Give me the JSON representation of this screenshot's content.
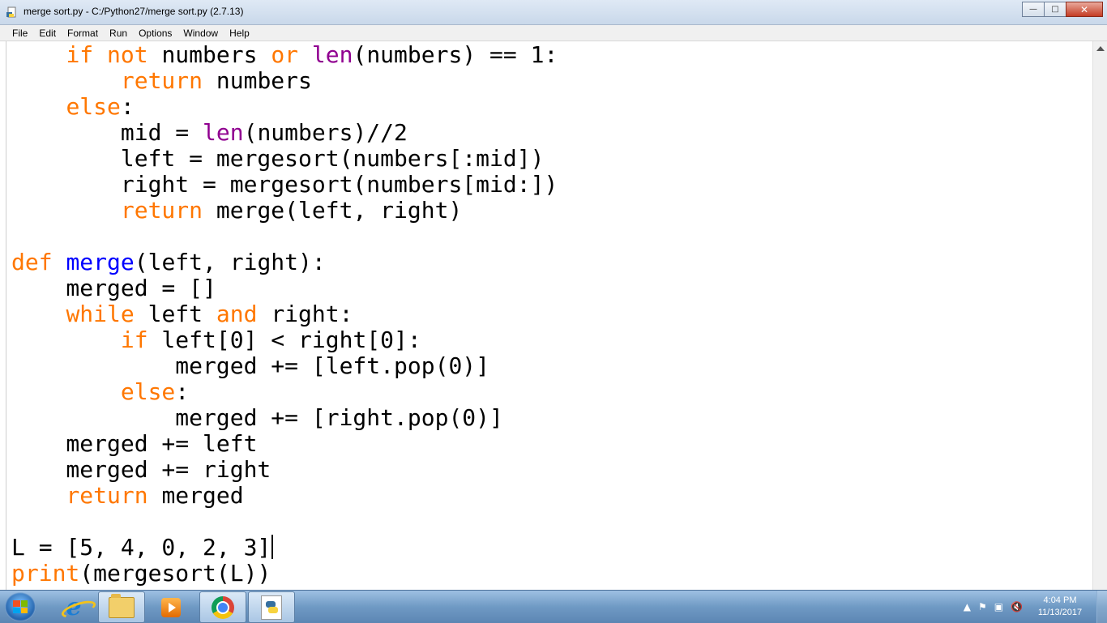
{
  "window": {
    "title": "merge sort.py - C:/Python27/merge sort.py (2.7.13)",
    "minimize_icon": "minimize-icon",
    "maximize_icon": "maximize-icon",
    "close_icon": "close-icon"
  },
  "menu": [
    "File",
    "Edit",
    "Format",
    "Run",
    "Options",
    "Window",
    "Help"
  ],
  "editor": {
    "lines": [
      [
        {
          "t": "    "
        },
        {
          "t": "if",
          "c": "kw"
        },
        {
          "t": " "
        },
        {
          "t": "not",
          "c": "kw"
        },
        {
          "t": " numbers "
        },
        {
          "t": "or",
          "c": "kw"
        },
        {
          "t": " "
        },
        {
          "t": "len",
          "c": "bi"
        },
        {
          "t": "(numbers) == 1:"
        }
      ],
      [
        {
          "t": "        "
        },
        {
          "t": "return",
          "c": "kw"
        },
        {
          "t": " numbers"
        }
      ],
      [
        {
          "t": "    "
        },
        {
          "t": "else",
          "c": "kw"
        },
        {
          "t": ":"
        }
      ],
      [
        {
          "t": "        mid = "
        },
        {
          "t": "len",
          "c": "bi"
        },
        {
          "t": "(numbers)//2"
        }
      ],
      [
        {
          "t": "        left = mergesort(numbers[:mid])"
        }
      ],
      [
        {
          "t": "        right = mergesort(numbers[mid:])"
        }
      ],
      [
        {
          "t": "        "
        },
        {
          "t": "return",
          "c": "kw"
        },
        {
          "t": " merge(left, right)"
        }
      ],
      [],
      [
        {
          "t": "def",
          "c": "kw"
        },
        {
          "t": " "
        },
        {
          "t": "merge",
          "c": "fn"
        },
        {
          "t": "(left, right):"
        }
      ],
      [
        {
          "t": "    merged = []"
        }
      ],
      [
        {
          "t": "    "
        },
        {
          "t": "while",
          "c": "kw"
        },
        {
          "t": " left "
        },
        {
          "t": "and",
          "c": "kw"
        },
        {
          "t": " right:"
        }
      ],
      [
        {
          "t": "        "
        },
        {
          "t": "if",
          "c": "kw"
        },
        {
          "t": " left[0] < right[0]:"
        }
      ],
      [
        {
          "t": "            merged += [left.pop(0)]"
        }
      ],
      [
        {
          "t": "        "
        },
        {
          "t": "else",
          "c": "kw"
        },
        {
          "t": ":"
        }
      ],
      [
        {
          "t": "            merged += [right.pop(0)]"
        }
      ],
      [
        {
          "t": "    merged += left"
        }
      ],
      [
        {
          "t": "    merged += right"
        }
      ],
      [
        {
          "t": "    "
        },
        {
          "t": "return",
          "c": "kw"
        },
        {
          "t": " merged"
        }
      ],
      [],
      [
        {
          "t": "L = [5, 4, 0, 2, 3]"
        },
        {
          "caret": true
        }
      ],
      [
        {
          "t": "print",
          "c": "kw"
        },
        {
          "t": "(mergesort(L))"
        }
      ]
    ],
    "colors": {
      "keyword": "#ff7700",
      "builtin": "#900090",
      "definition": "#0000ff",
      "text": "#000000"
    }
  },
  "taskbar": {
    "apps": [
      {
        "name": "internet-explorer-icon"
      },
      {
        "name": "file-explorer-icon"
      },
      {
        "name": "media-player-icon"
      },
      {
        "name": "chrome-icon"
      },
      {
        "name": "python-idle-icon"
      }
    ],
    "tray_icons": [
      "show-hidden-icons-arrow",
      "action-center-flag-icon",
      "network-icon",
      "volume-muted-icon"
    ],
    "time": "4:04 PM",
    "date": "11/13/2017"
  }
}
